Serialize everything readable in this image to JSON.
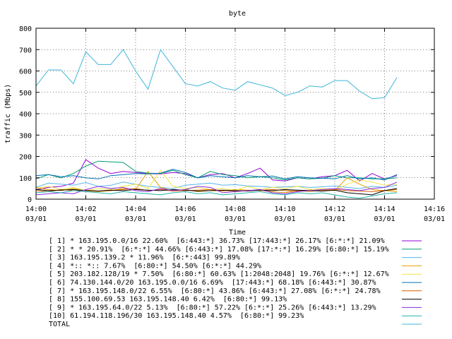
{
  "chart_data": {
    "type": "line",
    "title": "byte",
    "xlabel": "Time",
    "ylabel": "traffic (Mbps)",
    "ylim": [
      0,
      800
    ],
    "yticks": [
      "0",
      "100",
      "200",
      "300",
      "400",
      "500",
      "600",
      "700",
      "800"
    ],
    "xlim_minutes": [
      0,
      16
    ],
    "xticks": [
      {
        "time": "14:00",
        "date": "03/01"
      },
      {
        "time": "14:02",
        "date": "03/01"
      },
      {
        "time": "14:04",
        "date": "03/01"
      },
      {
        "time": "14:06",
        "date": "03/01"
      },
      {
        "time": "14:08",
        "date": "03/01"
      },
      {
        "time": "14:10",
        "date": "03/01"
      },
      {
        "time": "14:12",
        "date": "03/01"
      },
      {
        "time": "14:14",
        "date": "03/01"
      },
      {
        "time": "14:16",
        "date": "03/01"
      }
    ],
    "grid": true,
    "legend_position": "bottom",
    "x": [
      "14:00:00",
      "14:00:30",
      "14:01:00",
      "14:01:30",
      "14:02:00",
      "14:02:30",
      "14:03:00",
      "14:03:30",
      "14:04:00",
      "14:04:30",
      "14:05:00",
      "14:05:30",
      "14:06:00",
      "14:06:30",
      "14:07:00",
      "14:07:30",
      "14:08:00",
      "14:08:30",
      "14:09:00",
      "14:09:30",
      "14:10:00",
      "14:10:30",
      "14:11:00",
      "14:11:30",
      "14:12:00",
      "14:12:30",
      "14:13:00",
      "14:13:30",
      "14:14:00",
      "14:14:30"
    ],
    "series": [
      {
        "name": "[ 1] * 163.195.0.0/16 22.60%  [6:443:*] 36.73% [17:443:*] 26.17% [6:*:*] 21.09%",
        "color": "#9400d3",
        "values": [
          45,
          55,
          60,
          75,
          185,
          145,
          120,
          130,
          125,
          120,
          118,
          125,
          120,
          100,
          115,
          120,
          100,
          120,
          145,
          90,
          85,
          100,
          95,
          105,
          110,
          135,
          85,
          120,
          95,
          110
        ]
      },
      {
        "name": "[ 2] * * 20.91%  [6:*:*] 44.66% [6:443:*] 17.08% [17:*:*] 16.29% [6:80:*] 15.19%",
        "color": "#009e73",
        "values": [
          95,
          115,
          100,
          120,
          155,
          178,
          175,
          172,
          130,
          122,
          120,
          135,
          115,
          100,
          130,
          115,
          110,
          100,
          105,
          100,
          90,
          100,
          95,
          98,
          110,
          100,
          100,
          95,
          95,
          100
        ]
      },
      {
        "name": "[ 3] 163.195.139.2 * 11.96%  [6:*:443] 99.89%",
        "color": "#56b4e9",
        "values": [
          55,
          75,
          70,
          65,
          78,
          60,
          65,
          80,
          70,
          60,
          55,
          50,
          65,
          70,
          75,
          65,
          68,
          62,
          60,
          55,
          58,
          60,
          55,
          58,
          62,
          55,
          50,
          60,
          55,
          65
        ]
      },
      {
        "name": "[ 4] *:: *:: 7.67%  [6:80:*] 54.50% [6:*:*] 44.29%",
        "color": "#e69f00",
        "values": [
          55,
          45,
          40,
          50,
          40,
          35,
          40,
          50,
          45,
          130,
          55,
          40,
          45,
          35,
          40,
          38,
          45,
          42,
          40,
          35,
          30,
          40,
          35,
          45,
          40,
          100,
          70,
          45,
          40,
          35
        ]
      },
      {
        "name": "[ 5] 203.182.128/19 * 7.50%  [6:80:*] 60.63% [1:2048:2048] 19.76% [6:*:*] 12.67%",
        "color": "#f0e442",
        "values": [
          50,
          60,
          45,
          55,
          40,
          50,
          45,
          60,
          70,
          50,
          135,
          60,
          50,
          55,
          45,
          50,
          40,
          60,
          45,
          55,
          50,
          60,
          45,
          50,
          40,
          70,
          90,
          80,
          65,
          70
        ]
      },
      {
        "name": "[ 6] 74.130.144.0/20 163.195.0.0/16 6.69%  [17:443:*] 68.18% [6:443:*] 30.87%",
        "color": "#0072b2",
        "values": [
          110,
          115,
          105,
          110,
          100,
          95,
          110,
          115,
          120,
          118,
          122,
          140,
          125,
          100,
          110,
          105,
          100,
          110,
          105,
          108,
          95,
          105,
          100,
          98,
          95,
          110,
          95,
          100,
          90,
          115
        ]
      },
      {
        "name": "[ 7] * 163.195.148.0/22 6.55%  [6:80:*] 43.86% [6:443:*] 27.08% [6:*:*] 24.78%",
        "color": "#d55e00",
        "values": [
          40,
          35,
          45,
          40,
          42,
          38,
          40,
          45,
          50,
          40,
          45,
          38,
          40,
          42,
          45,
          40,
          38,
          40,
          42,
          45,
          40,
          38,
          42,
          40,
          45,
          40,
          38,
          35,
          40,
          45
        ]
      },
      {
        "name": "[ 8] 155.100.69.53 163.195.148.40 6.42%  [6:80:*] 99.13%",
        "color": "#000000",
        "values": [
          45,
          40,
          42,
          45,
          40,
          38,
          42,
          40,
          45,
          42,
          40,
          45,
          42,
          38,
          40,
          42,
          40,
          38,
          42,
          40,
          45,
          42,
          40,
          38,
          42,
          30,
          25,
          20,
          40,
          50
        ]
      },
      {
        "name": "[ 9] * 163.195.64.0/22 5.13%  [6:80:*] 57.22% [6:*:*] 25.26% [6:443:*] 13.29%",
        "color": "#8a2be2",
        "values": [
          20,
          25,
          30,
          25,
          45,
          60,
          50,
          55,
          40,
          35,
          50,
          40,
          45,
          60,
          55,
          30,
          35,
          40,
          45,
          30,
          25,
          35,
          40,
          45,
          50,
          45,
          40,
          50,
          55,
          80
        ]
      },
      {
        "name": "[10] 61.194.118.196/30 163.195.148.40 4.57%  [6:80:*] 99.23%",
        "color": "#20b2aa",
        "values": [
          30,
          35,
          30,
          40,
          35,
          30,
          25,
          35,
          30,
          25,
          20,
          30,
          35,
          25,
          30,
          20,
          25,
          30,
          35,
          25,
          20,
          30,
          25,
          30,
          20,
          10,
          5,
          15,
          25,
          30
        ]
      },
      {
        "name": "TOTAL",
        "color": "#40b5d8",
        "values": [
          530,
          605,
          605,
          540,
          690,
          630,
          630,
          700,
          600,
          515,
          700,
          620,
          540,
          530,
          550,
          520,
          510,
          550,
          535,
          520,
          485,
          500,
          530,
          525,
          555,
          555,
          505,
          470,
          475,
          570
        ]
      }
    ]
  }
}
